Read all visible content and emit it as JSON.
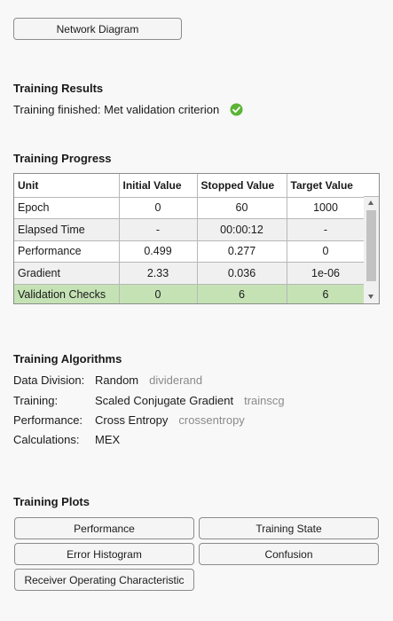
{
  "network_diagram_button": "Network Diagram",
  "results": {
    "title": "Training Results",
    "status": "Training finished: Met validation criterion",
    "status_icon": "check-circle-icon",
    "status_color": "#5bb436"
  },
  "progress": {
    "title": "Training Progress",
    "columns": [
      "Unit",
      "Initial Value",
      "Stopped Value",
      "Target Value"
    ],
    "rows": [
      [
        "Epoch",
        "0",
        "60",
        "1000"
      ],
      [
        "Elapsed Time",
        "-",
        "00:00:12",
        "-"
      ],
      [
        "Performance",
        "0.499",
        "0.277",
        "0"
      ],
      [
        "Gradient",
        "2.33",
        "0.036",
        "1e-06"
      ],
      [
        "Validation Checks",
        "0",
        "6",
        "6"
      ]
    ],
    "highlight_color": "#c5e2b5"
  },
  "algorithms": {
    "title": "Training Algorithms",
    "items": [
      {
        "label": "Data Division:",
        "value": "Random",
        "code": "dividerand"
      },
      {
        "label": "Training:",
        "value": "Scaled Conjugate Gradient",
        "code": "trainscg"
      },
      {
        "label": "Performance:",
        "value": "Cross Entropy",
        "code": "crossentropy"
      },
      {
        "label": "Calculations:",
        "value": "MEX",
        "code": ""
      }
    ]
  },
  "plots": {
    "title": "Training Plots",
    "buttons": [
      "Performance",
      "Training State",
      "Error Histogram",
      "Confusion",
      "Receiver Operating Characteristic"
    ]
  }
}
